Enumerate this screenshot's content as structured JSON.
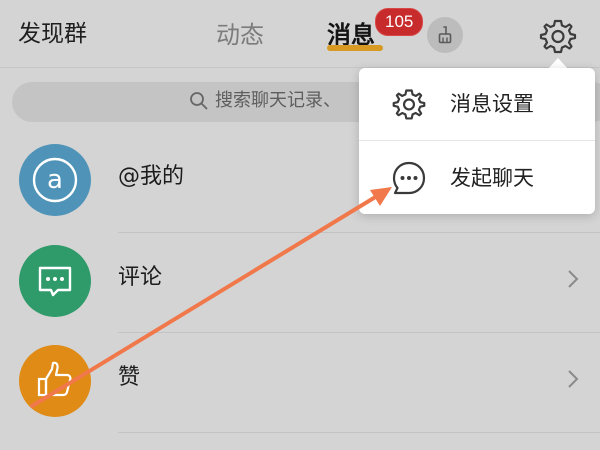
{
  "header": {
    "left_title": "发现群",
    "tab_dongtai": "动态",
    "tab_xiaoxi": "消息",
    "badge_count": "105",
    "broom_icon": "broom-icon",
    "settings_icon": "gear-icon"
  },
  "search": {
    "placeholder": "搜索聊天记录、"
  },
  "list": {
    "items": [
      {
        "label": "@我的",
        "icon": "at-icon",
        "color": "#4f94b8"
      },
      {
        "label": "评论",
        "icon": "comment-icon",
        "color": "#2f9a6a"
      },
      {
        "label": "赞",
        "icon": "thumbs-up-icon",
        "color": "#df8b16"
      }
    ]
  },
  "menu": {
    "items": [
      {
        "label": "消息设置",
        "icon": "gear-icon"
      },
      {
        "label": "发起聊天",
        "icon": "chat-bubble-icon"
      }
    ]
  },
  "colors": {
    "background": "#d4d4d4",
    "badge": "#c82b2b",
    "tab_underline": "#d89a22",
    "annotation_arrow": "#f0784a"
  }
}
